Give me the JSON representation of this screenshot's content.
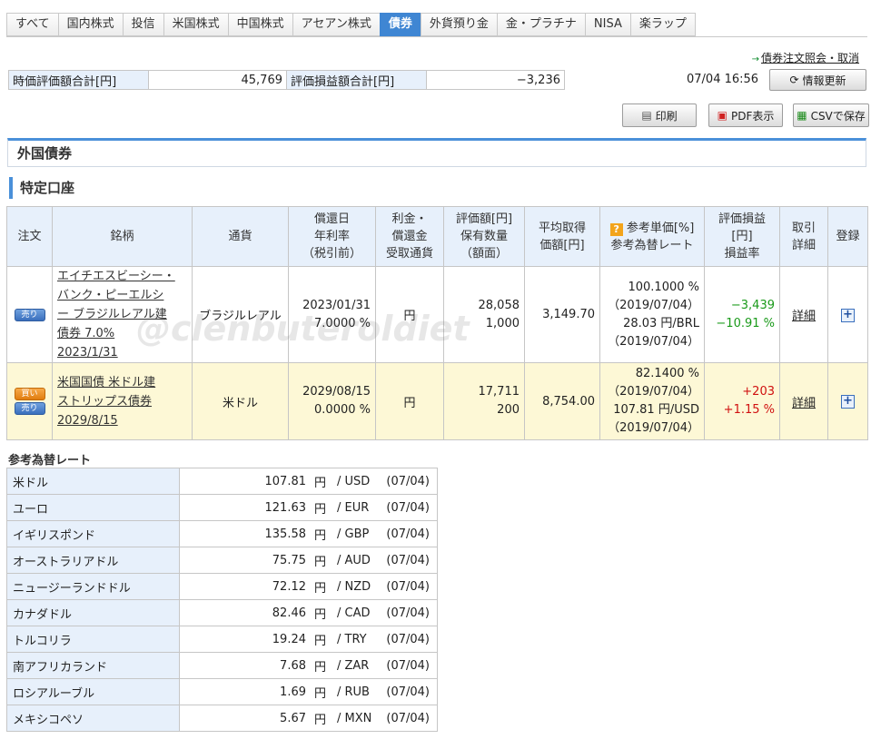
{
  "tabs": [
    "すべて",
    "国内株式",
    "投信",
    "米国株式",
    "中国株式",
    "アセアン株式",
    "債券",
    "外貨預り金",
    "金・プラチナ",
    "NISA",
    "楽ラップ"
  ],
  "active_tab": "債券",
  "top_link": "債券注文照会・取消",
  "summary": {
    "valuation_label": "時価評価額合計[円]",
    "valuation_value": "45,769",
    "pnl_label": "評価損益額合計[円]",
    "pnl_value": "−3,236"
  },
  "updated_at": "07/04 16:56",
  "buttons": {
    "refresh": "情報更新",
    "print": "印刷",
    "pdf": "PDF表示",
    "csv": "CSVで保存"
  },
  "section_title": "外国債券",
  "account_title": "特定口座",
  "table": {
    "headers": {
      "order": "注文",
      "name": "銘柄",
      "currency": "通貨",
      "redemption_1": "償還日",
      "redemption_2": "年利率",
      "redemption_3": "（税引前）",
      "interest_1": "利金・",
      "interest_2": "償還金",
      "interest_3": "受取通貨",
      "value_1": "評価額[円]",
      "value_2": "保有数量",
      "value_3": "（額面）",
      "avg_1": "平均取得",
      "avg_2": "価額[円]",
      "ref_1": "参考単価[%]",
      "ref_2": "参考為替レート",
      "pnl_1": "評価損益",
      "pnl_2": "[円]",
      "pnl_3": "損益率",
      "trade_1": "取引",
      "trade_2": "詳細",
      "register": "登録"
    },
    "rows": [
      {
        "sell": "売り",
        "name_lines": [
          "エイチエスビーシー・",
          "バンク・ピーエルシ",
          "ー ブラジルレアル建",
          "債券 7.0%",
          "2023/1/31"
        ],
        "currency": "ブラジルレアル",
        "redemption": "2023/01/31",
        "rate": "7.0000 %",
        "receipt": "円",
        "value": "28,058",
        "qty": "1,000",
        "avg": "3,149.70",
        "ref_price": "100.1000 %",
        "ref_date1": "（2019/07/04）",
        "ref_fx": "28.03 円/BRL",
        "ref_date2": "（2019/07/04）",
        "pnl": "−3,439",
        "pnl_rate": "−10.91 %",
        "detail": "詳細"
      },
      {
        "buy": "買い",
        "sell": "売り",
        "name_lines": [
          "米国国債 米ドル建",
          "ストリップス債券",
          "2029/8/15"
        ],
        "currency": "米ドル",
        "redemption": "2029/08/15",
        "rate": "0.0000 %",
        "receipt": "円",
        "value": "17,711",
        "qty": "200",
        "avg": "8,754.00",
        "ref_price": "82.1400 %",
        "ref_date1": "（2019/07/04）",
        "ref_fx": "107.81 円/USD",
        "ref_date2": "（2019/07/04）",
        "pnl": "+203",
        "pnl_rate": "+1.15 %",
        "detail": "詳細"
      }
    ]
  },
  "watermark": "@clenbuteroldiet",
  "rates_title": "参考為替レート",
  "rates": [
    {
      "name": "米ドル",
      "value": "107.81",
      "unit": "円",
      "cur": "/ USD",
      "date": "(07/04)"
    },
    {
      "name": "ユーロ",
      "value": "121.63",
      "unit": "円",
      "cur": "/ EUR",
      "date": "(07/04)"
    },
    {
      "name": "イギリスポンド",
      "value": "135.58",
      "unit": "円",
      "cur": "/ GBP",
      "date": "(07/04)"
    },
    {
      "name": "オーストラリアドル",
      "value": "75.75",
      "unit": "円",
      "cur": "/ AUD",
      "date": "(07/04)"
    },
    {
      "name": "ニュージーランドドル",
      "value": "72.12",
      "unit": "円",
      "cur": "/ NZD",
      "date": "(07/04)"
    },
    {
      "name": "カナダドル",
      "value": "82.46",
      "unit": "円",
      "cur": "/ CAD",
      "date": "(07/04)"
    },
    {
      "name": "トルコリラ",
      "value": "19.24",
      "unit": "円",
      "cur": "/ TRY",
      "date": "(07/04)"
    },
    {
      "name": "南アフリカランド",
      "value": "7.68",
      "unit": "円",
      "cur": "/ ZAR",
      "date": "(07/04)"
    },
    {
      "name": "ロシアルーブル",
      "value": "1.69",
      "unit": "円",
      "cur": "/ RUB",
      "date": "(07/04)"
    },
    {
      "name": "メキシコペソ",
      "value": "5.67",
      "unit": "円",
      "cur": "/ MXN",
      "date": "(07/04)"
    }
  ]
}
